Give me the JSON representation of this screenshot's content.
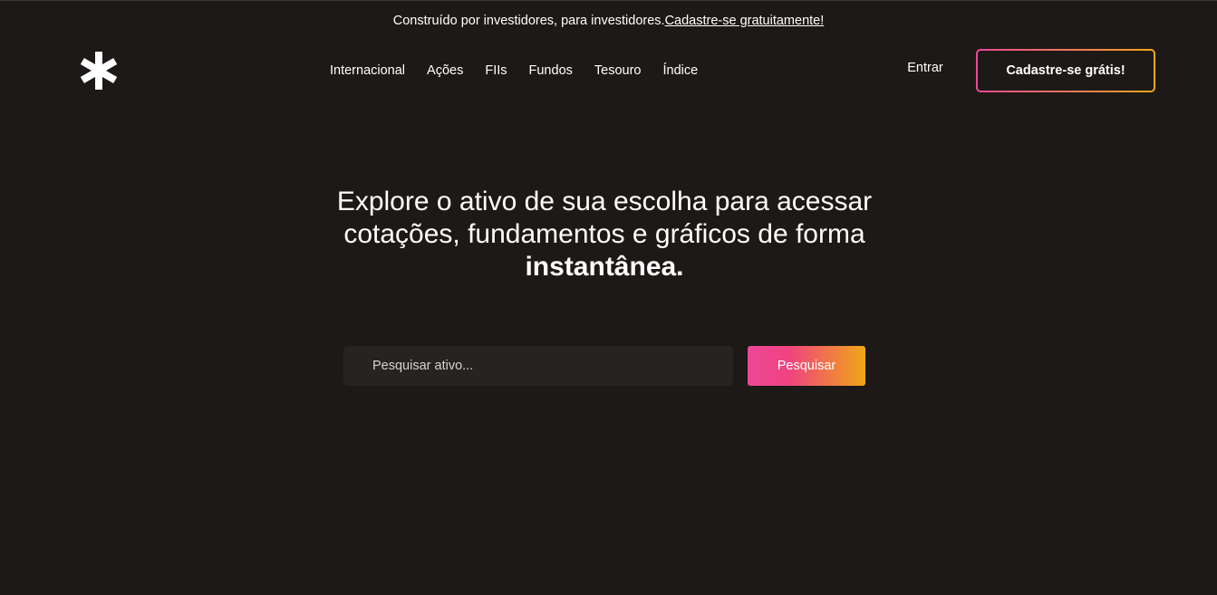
{
  "announcement": {
    "text": "Construído por investidores, para investidores.",
    "link_label": "Cadastre-se gratuitamente!"
  },
  "nav": {
    "items": [
      {
        "label": "Internacional"
      },
      {
        "label": "Ações"
      },
      {
        "label": "FIIs"
      },
      {
        "label": "Fundos"
      },
      {
        "label": "Tesouro"
      },
      {
        "label": "Índice"
      }
    ]
  },
  "header": {
    "login_label": "Entrar",
    "signup_label": "Cadastre-se grátis!"
  },
  "hero": {
    "heading": "Explore o ativo de sua escolha para acessar cotações, fundamentos e gráficos de forma",
    "heading_emphasis": "instantânea."
  },
  "search": {
    "placeholder": "Pesquisar ativo...",
    "value": "",
    "button_label": "Pesquisar"
  },
  "colors": {
    "background": "#1d1917",
    "input_background": "#272322",
    "gradient_start": "#ec4899",
    "gradient_end": "#f2a61a",
    "text": "#ffffff"
  },
  "icons": {
    "logo": "asterisk-logo-icon"
  }
}
